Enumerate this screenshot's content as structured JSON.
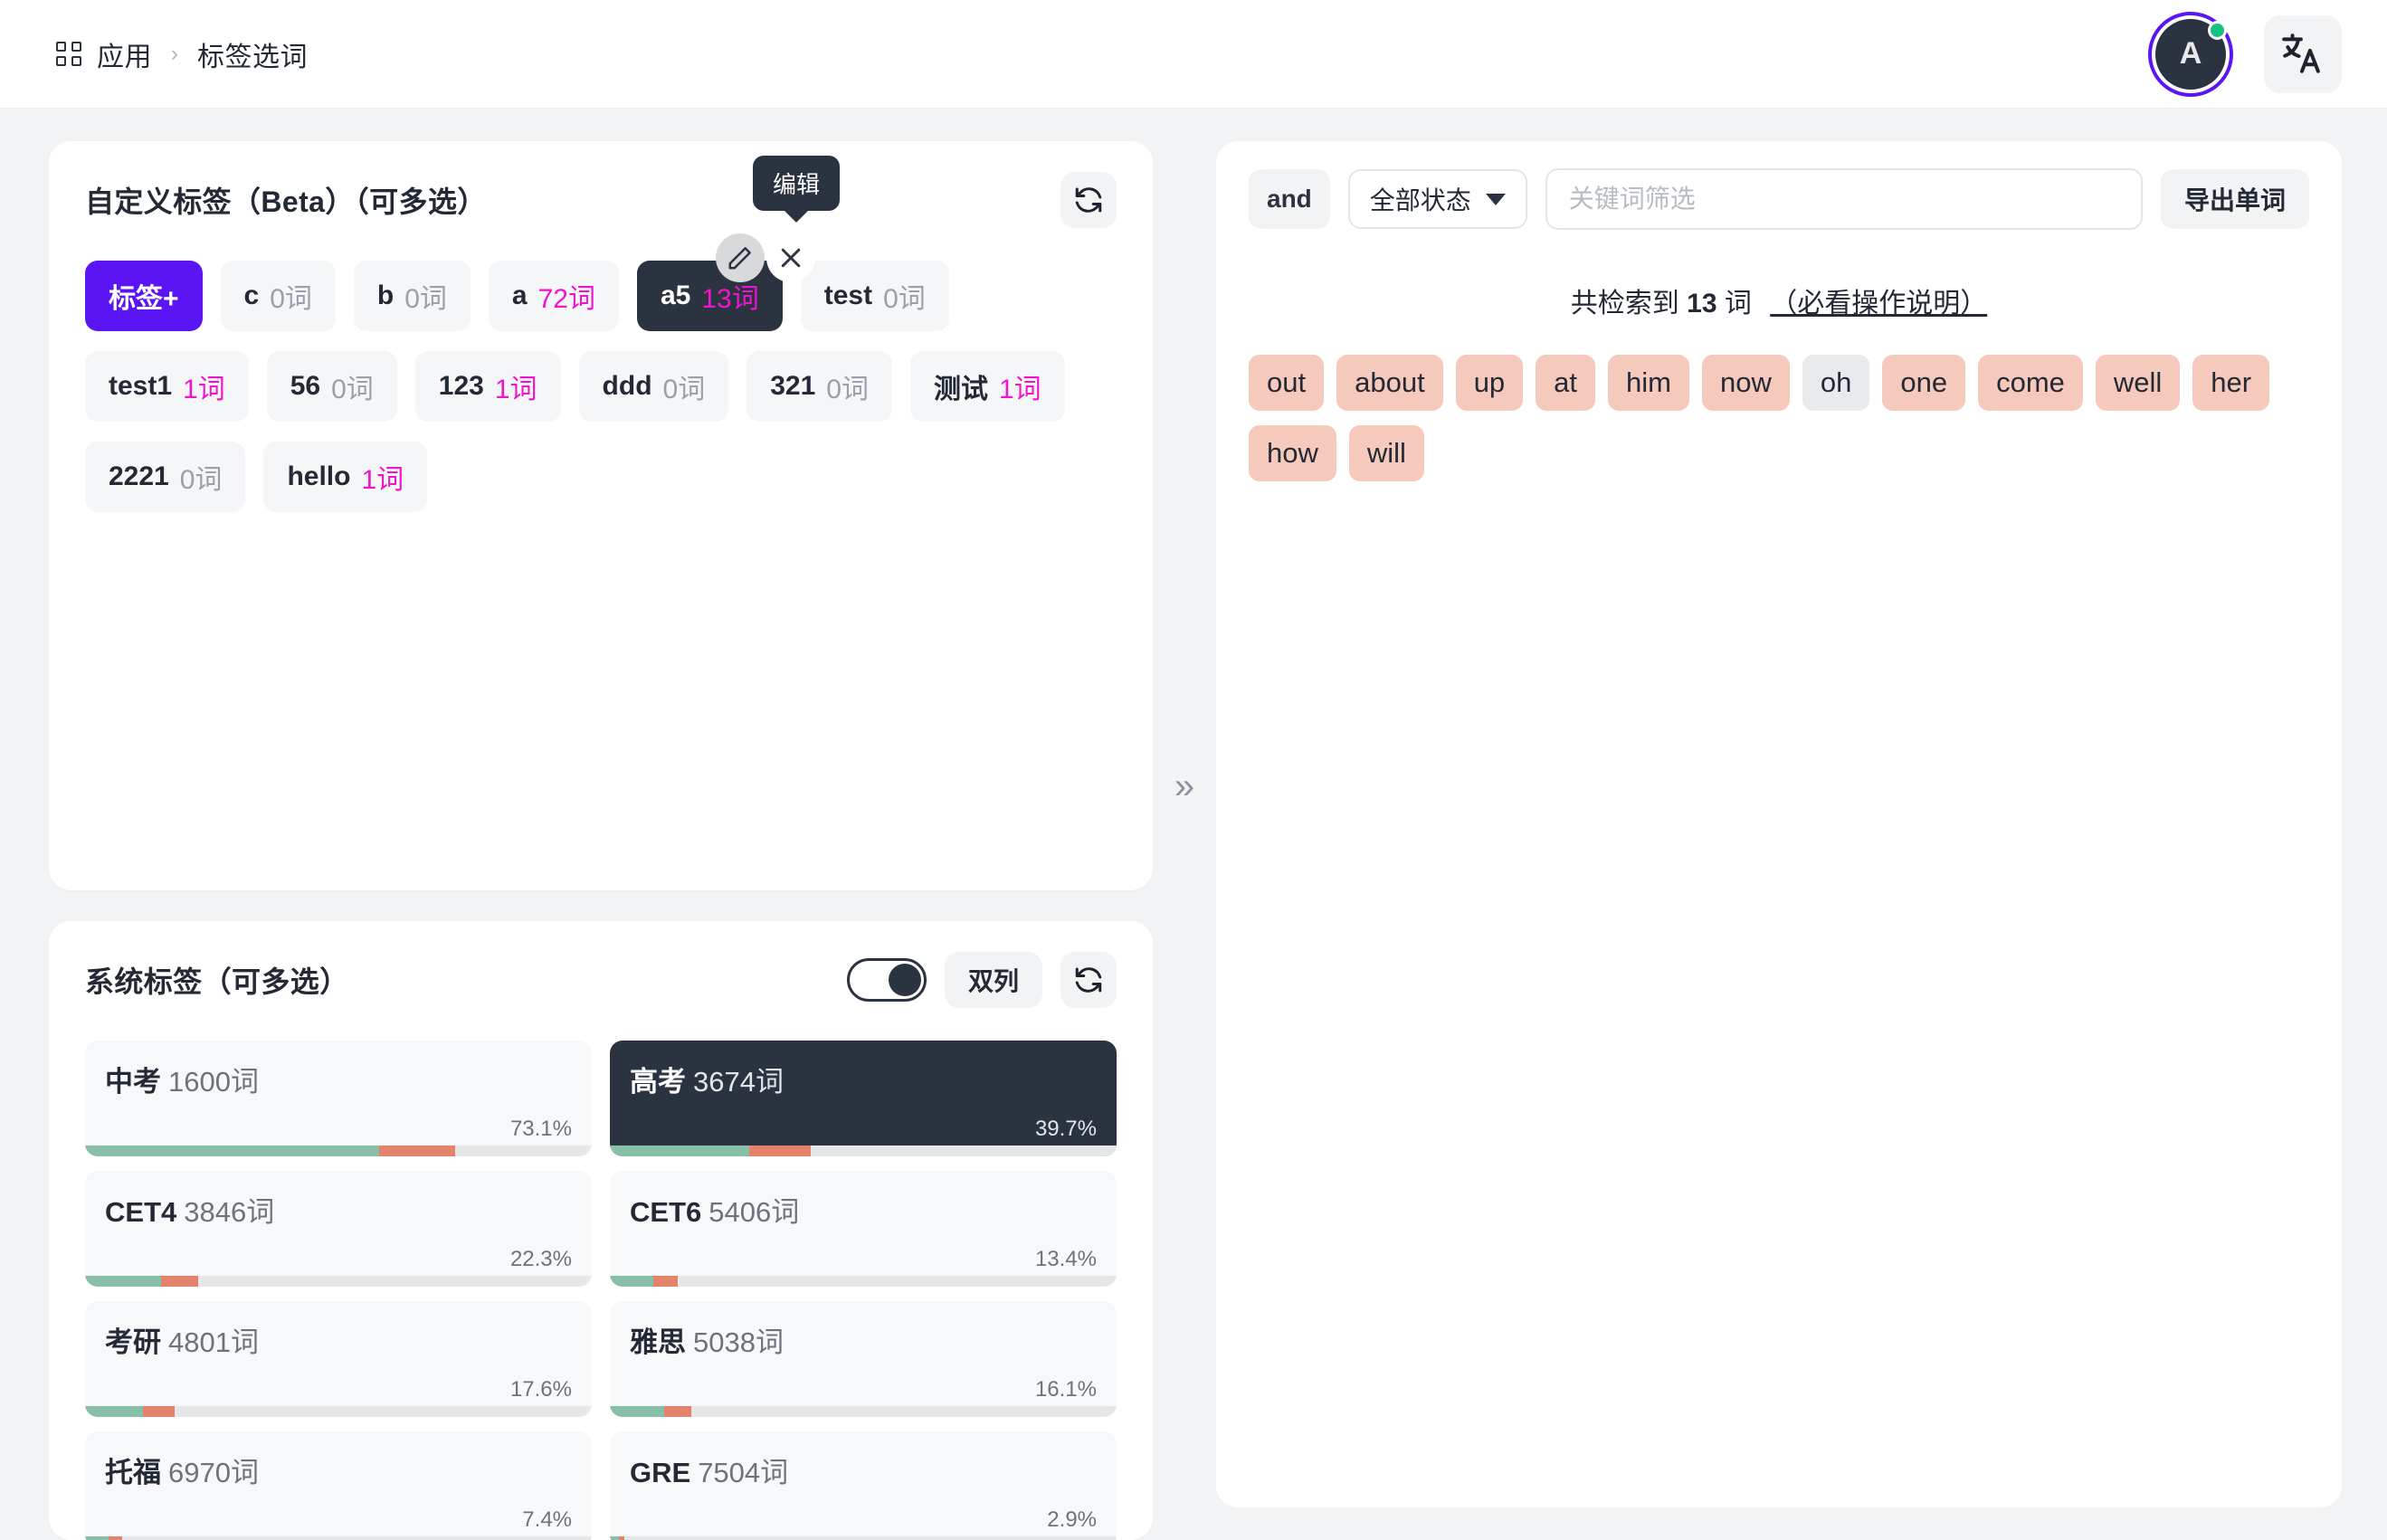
{
  "topbar": {
    "grid_icon": "grid-icon",
    "breadcrumb_app": "应用",
    "breadcrumb_sep": "›",
    "breadcrumb_current": "标签选词",
    "avatar_initial": "A",
    "avatar_ring_color": "#5b15f5",
    "status_color": "#17c07f",
    "lang_icon": "translate-icon"
  },
  "custom_tags_card": {
    "title": "自定义标签（Beta）（可多选）",
    "refresh_icon": "refresh-icon",
    "tooltip": "编辑",
    "add_label": "标签+",
    "edit_icon": "pencil-icon",
    "delete_icon": "close-icon",
    "unit": "词",
    "accent_count_color": "#f014cf",
    "tags": [
      {
        "name": "c",
        "count": "0",
        "has": false,
        "selected": false
      },
      {
        "name": "b",
        "count": "0",
        "has": false,
        "selected": false
      },
      {
        "name": "a",
        "count": "72",
        "has": true,
        "selected": false
      },
      {
        "name": "a5",
        "count": "13",
        "has": true,
        "selected": true
      },
      {
        "name": "test",
        "count": "0",
        "has": false,
        "selected": false
      },
      {
        "name": "test1",
        "count": "1",
        "has": true,
        "selected": false
      },
      {
        "name": "56",
        "count": "0",
        "has": false,
        "selected": false
      },
      {
        "name": "123",
        "count": "1",
        "has": true,
        "selected": false
      },
      {
        "name": "ddd",
        "count": "0",
        "has": false,
        "selected": false
      },
      {
        "name": "321",
        "count": "0",
        "has": false,
        "selected": false
      },
      {
        "name": "测试",
        "count": "1",
        "has": true,
        "selected": false
      },
      {
        "name": "2221",
        "count": "0",
        "has": false,
        "selected": false
      },
      {
        "name": "hello",
        "count": "1",
        "has": true,
        "selected": false
      }
    ]
  },
  "panel_divider": {
    "collapse_icon": "»"
  },
  "system_tags_card": {
    "title": "系统标签（可多选）",
    "toggle_on": true,
    "column_label": "双列",
    "refresh_icon": "refresh-icon",
    "unit": "词",
    "bar_green": "#87bfa7",
    "bar_red": "#e3836c",
    "items": [
      {
        "name": "中考",
        "count": "1600",
        "pct": "73.1%",
        "green": 58.0,
        "red": 15.1,
        "selected": false
      },
      {
        "name": "高考",
        "count": "3674",
        "pct": "39.7%",
        "green": 27.5,
        "red": 12.2,
        "selected": true
      },
      {
        "name": "CET4",
        "count": "3846",
        "pct": "22.3%",
        "green": 15.0,
        "red": 7.3,
        "selected": false
      },
      {
        "name": "CET6",
        "count": "5406",
        "pct": "13.4%",
        "green": 8.6,
        "red": 4.8,
        "selected": false
      },
      {
        "name": "考研",
        "count": "4801",
        "pct": "17.6%",
        "green": 11.5,
        "red": 6.1,
        "selected": false
      },
      {
        "name": "雅思",
        "count": "5038",
        "pct": "16.1%",
        "green": 10.8,
        "red": 5.3,
        "selected": false
      },
      {
        "name": "托福",
        "count": "6970",
        "pct": "7.4%",
        "green": 4.6,
        "red": 2.8,
        "selected": false
      },
      {
        "name": "GRE",
        "count": "7504",
        "pct": "2.9%",
        "green": 1.8,
        "red": 1.1,
        "selected": false
      }
    ]
  },
  "results_panel": {
    "and_label": "and",
    "status_select": "全部状态",
    "keyword_placeholder": "关键词筛选",
    "keyword_value": "",
    "export_label": "导出单词",
    "result_prefix": "共检索到",
    "result_count": "13",
    "result_suffix": "词",
    "result_link": "（必看操作说明）",
    "word_chip_color": "#f5c9bc",
    "word_chip_muted_color": "#e8eaec",
    "words": [
      {
        "text": "out",
        "muted": false
      },
      {
        "text": "about",
        "muted": false
      },
      {
        "text": "up",
        "muted": false
      },
      {
        "text": "at",
        "muted": false
      },
      {
        "text": "him",
        "muted": false
      },
      {
        "text": "now",
        "muted": false
      },
      {
        "text": "oh",
        "muted": true
      },
      {
        "text": "one",
        "muted": false
      },
      {
        "text": "come",
        "muted": false
      },
      {
        "text": "well",
        "muted": false
      },
      {
        "text": "her",
        "muted": false
      },
      {
        "text": "how",
        "muted": false
      },
      {
        "text": "will",
        "muted": false
      }
    ]
  }
}
